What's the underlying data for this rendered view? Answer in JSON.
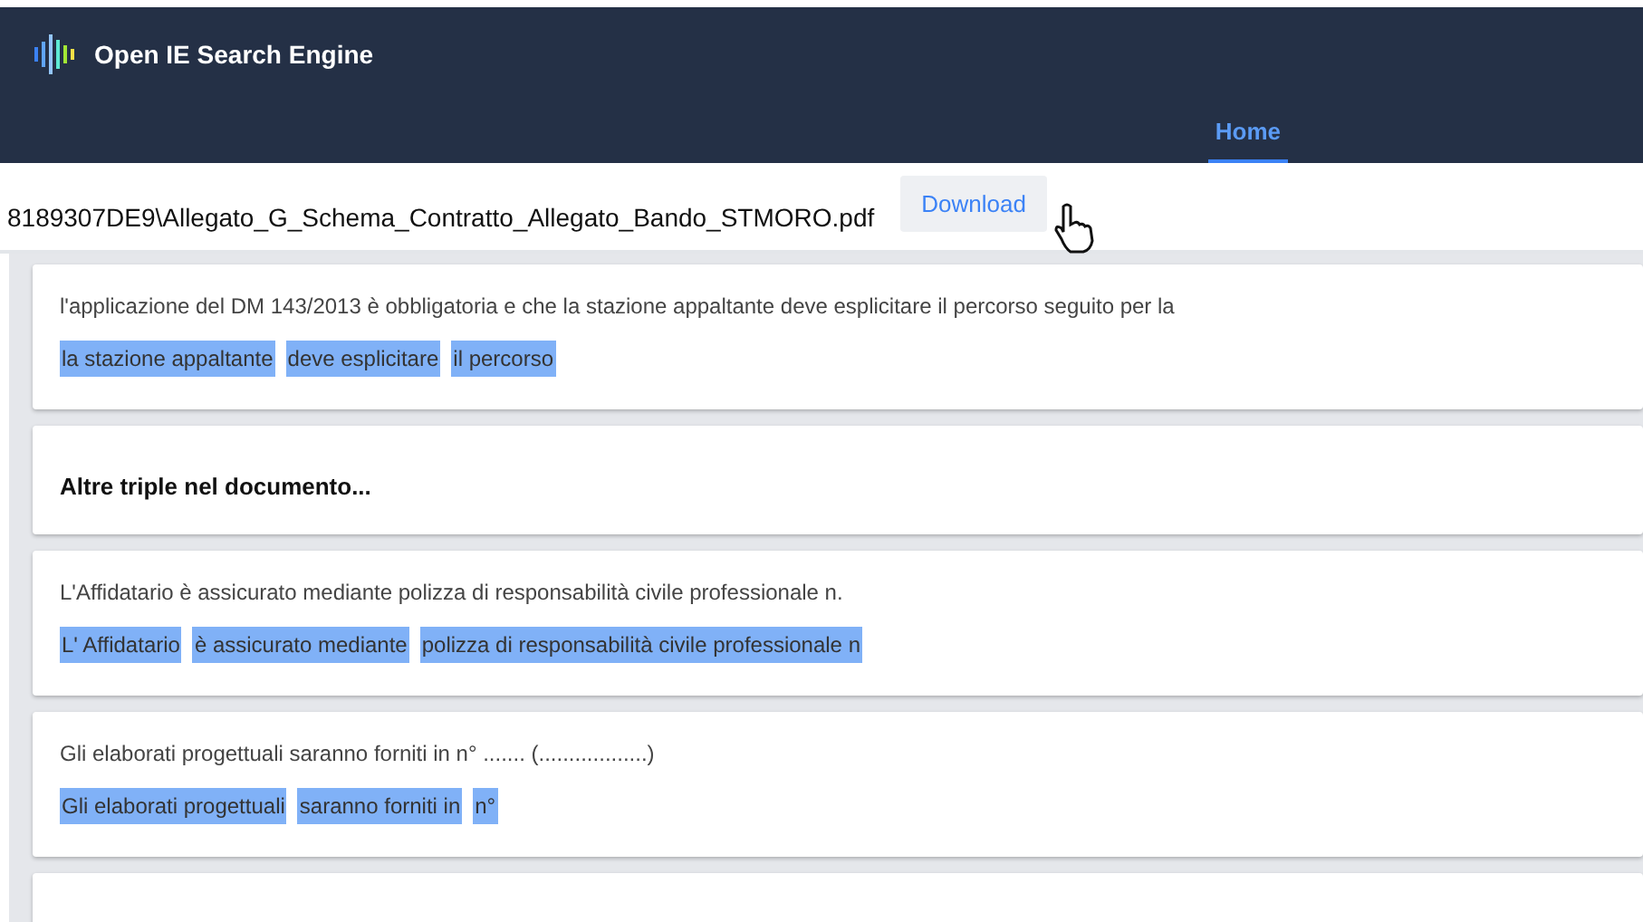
{
  "app": {
    "title": "Open IE Search Engine"
  },
  "nav": [
    {
      "label": "Home",
      "selected": true
    }
  ],
  "document": {
    "path": "8189307DE9\\Allegato_G_Schema_Contratto_Allegato_Bando_STMORO.pdf",
    "download": "Download"
  },
  "cards": [
    {
      "kind": "triple",
      "sentence": "l'applicazione del DM 143/2013 è obbligatoria e che la stazione appaltante deve esplicitare il percorso seguito per la",
      "triple": [
        "la stazione appaltante",
        "deve esplicitare",
        "il percorso"
      ]
    },
    {
      "kind": "note",
      "text": "Altre triple nel documento..."
    },
    {
      "kind": "triple",
      "sentence": "L'Affidatario è assicurato mediante polizza di responsabilità civile professionale n.",
      "triple": [
        "L' Affidatario",
        "è assicurato mediante",
        "polizza di responsabilità civile professionale n"
      ]
    },
    {
      "kind": "triple",
      "sentence": "Gli elaborati progettuali saranno forniti in n° ....... (..................)",
      "triple": [
        "Gli elaborati progettuali",
        "saranno forniti in",
        "n°"
      ]
    },
    {
      "kind": "empty"
    }
  ]
}
